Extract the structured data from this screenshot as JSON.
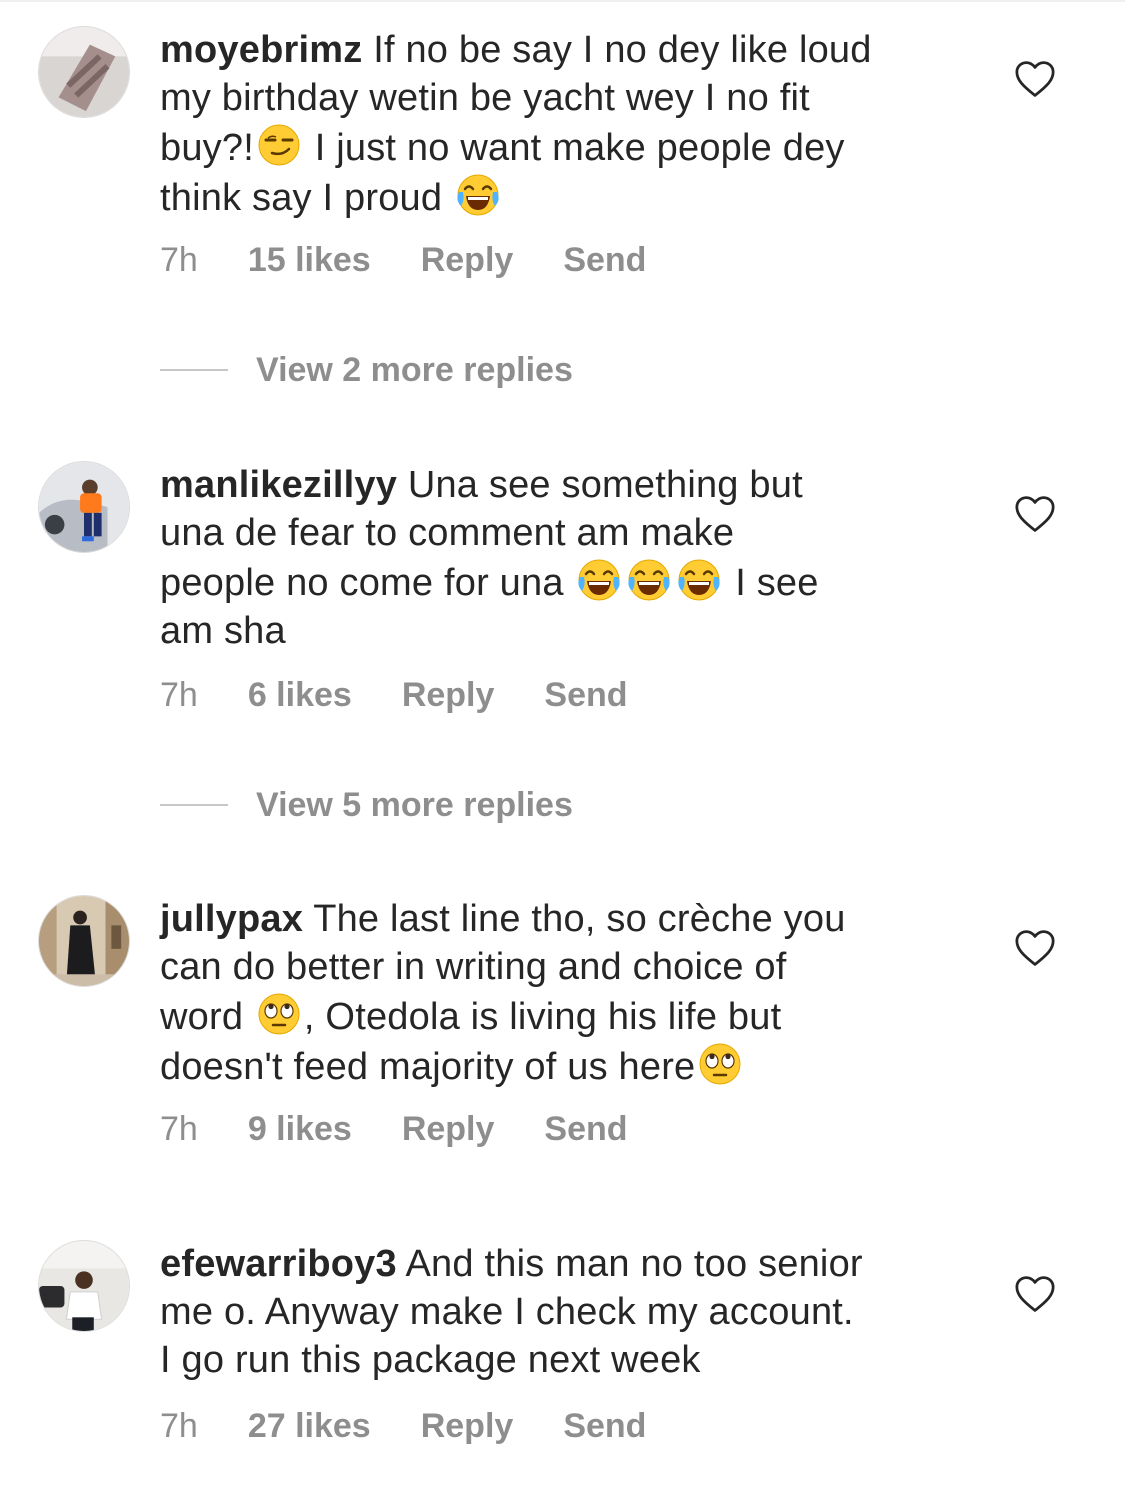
{
  "comments": [
    {
      "username": "moyebrimz",
      "lines": [
        "If no be say I no dey like loud",
        "my birthday wetin be yacht wey I no fit",
        "buy?!",
        " I just no want make people dey",
        "think say I proud "
      ],
      "time": "7h",
      "likes": "15 likes",
      "reply": "Reply",
      "send": "Send",
      "view_more": "View 2 more replies"
    },
    {
      "username": "manlikezillyy",
      "lines": [
        "Una see something but",
        "una de fear to comment  am make",
        "people no come for una ",
        " I see",
        "am sha"
      ],
      "time": "7h",
      "likes": "6 likes",
      "reply": "Reply",
      "send": "Send",
      "view_more": "View 5 more replies"
    },
    {
      "username": "jullypax",
      "lines": [
        "The last line tho, so crèche you",
        "can do better in writing and choice of",
        "word ",
        ", Otedola is living his life but",
        "doesn't feed majority of us here"
      ],
      "time": "7h",
      "likes": "9 likes",
      "reply": "Reply",
      "send": "Send"
    },
    {
      "username": "efewarriboy3",
      "lines": [
        "And this man no too senior",
        "me o. Anyway make I check my account.",
        "I go run this package next week"
      ],
      "time": "7h",
      "likes": "27 likes",
      "reply": "Reply",
      "send": "Send"
    }
  ],
  "emojis": {
    "smirk": "smirking-face-emoji",
    "laugh": "face-with-tears-of-joy-emoji",
    "eyeroll": "face-with-rolling-eyes-emoji"
  },
  "colors": {
    "text": "#262626",
    "meta": "#8e8e8e",
    "divider": "#c7c7c7",
    "emoji": "#ffcc33"
  }
}
